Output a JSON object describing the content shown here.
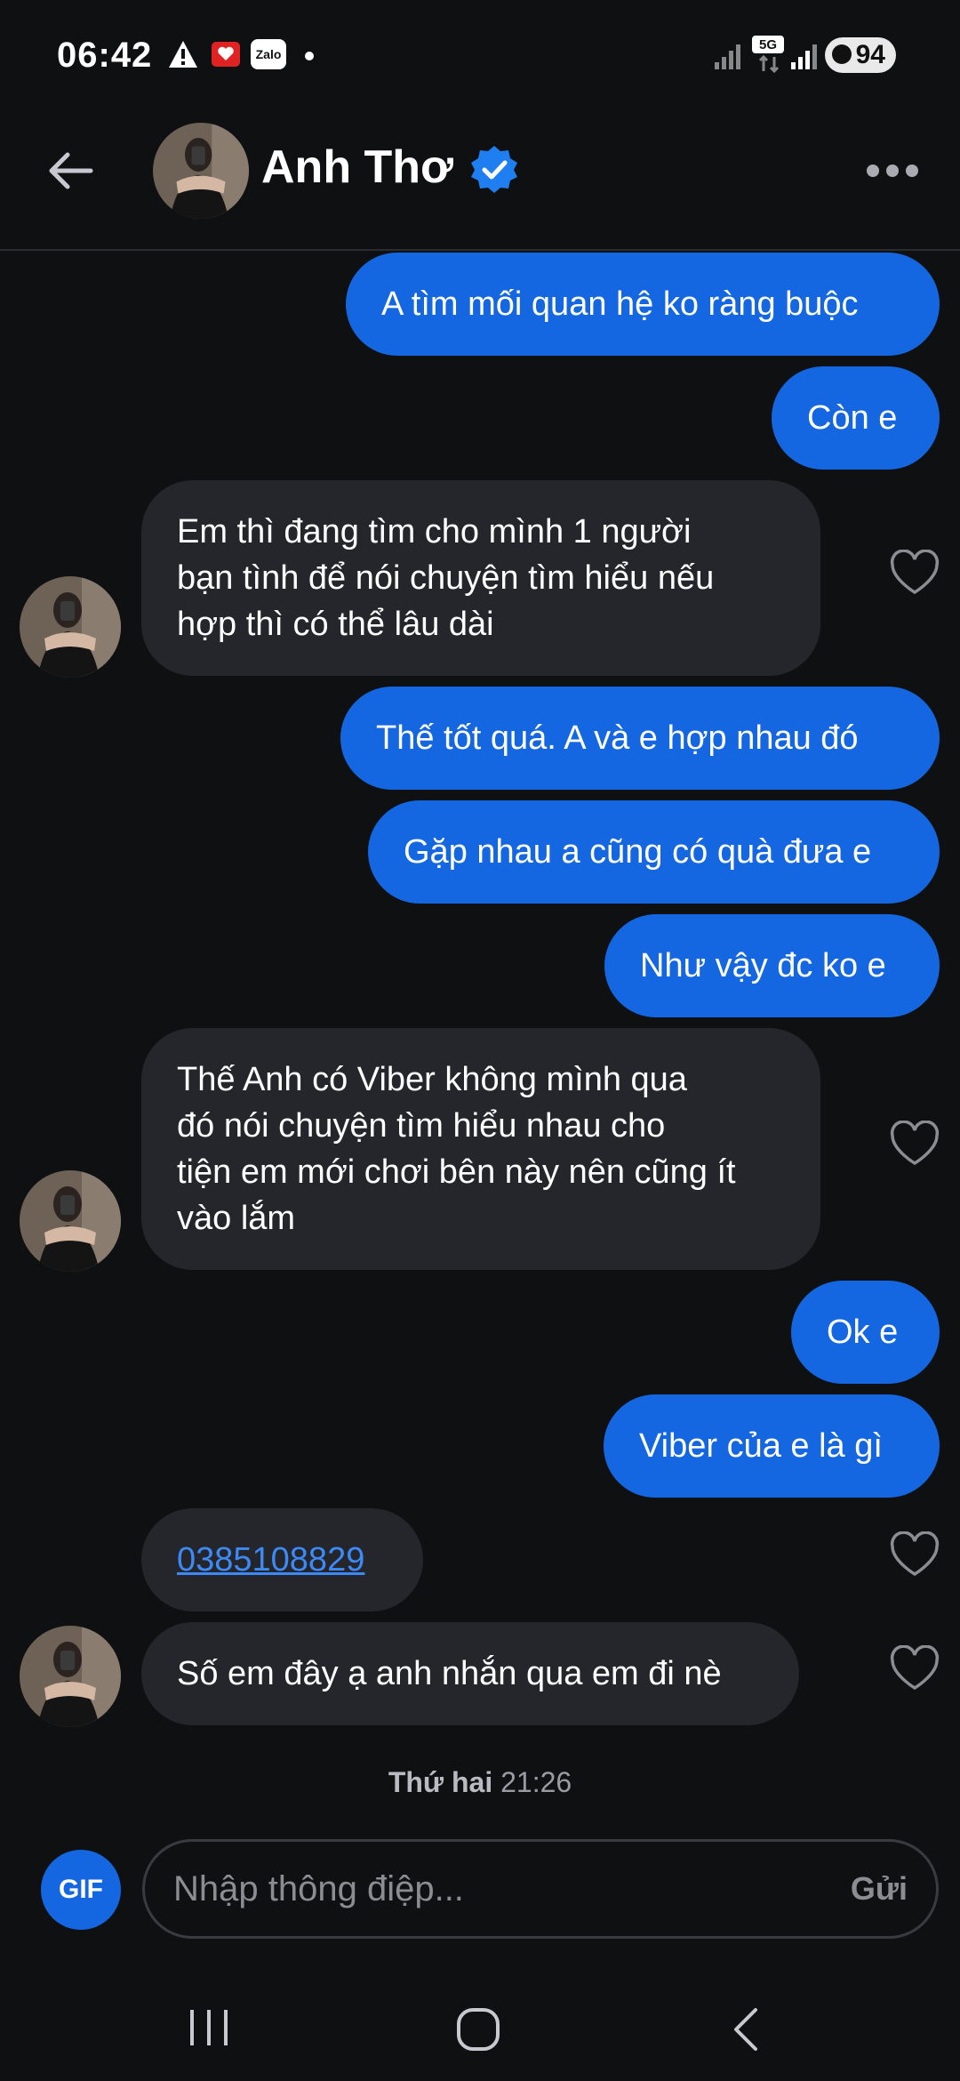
{
  "status_bar": {
    "time": "06:42",
    "notification_icons": [
      "warning-icon",
      "app-notification-icon",
      "zalo-icon",
      "dot-icon"
    ],
    "zalo_label": "Zalo",
    "network_label": "5G",
    "battery": "94"
  },
  "header": {
    "contact_name": "Anh Thơ",
    "verified": true
  },
  "messages": [
    {
      "from": "me",
      "text": "A tìm mối quan hệ ko ràng buộc"
    },
    {
      "from": "me",
      "text": "Còn e"
    },
    {
      "from": "them",
      "text": "Em thì đang tìm cho mình 1 người\nbạn tình để nói chuyện tìm hiểu nếu\nhợp thì có thể lâu dài"
    },
    {
      "from": "me",
      "text": "Thế tốt quá. A và e hợp nhau đó"
    },
    {
      "from": "me",
      "text": "Gặp nhau a cũng có quà đưa e"
    },
    {
      "from": "me",
      "text": "Như vậy đc ko e"
    },
    {
      "from": "them",
      "text": "Thế Anh có Viber không mình qua\nđó nói chuyện tìm hiểu nhau cho\ntiện em mới chơi bên này nên cũng ít\nvào lắm"
    },
    {
      "from": "me",
      "text": "Ok e"
    },
    {
      "from": "me",
      "text": "Viber của e là gì"
    },
    {
      "from": "them",
      "text": "0385108829",
      "type": "link"
    },
    {
      "from": "them",
      "text": "Số em đây ạ anh nhắn qua em đi nè"
    }
  ],
  "day_label": {
    "day": "Thứ hai",
    "time": "21:26"
  },
  "composer": {
    "gif_label": "GIF",
    "placeholder": "Nhập thông điệp...",
    "send_label": "Gửi"
  },
  "colors": {
    "background": "#0f1012",
    "outgoing_bubble": "#1467e0",
    "incoming_bubble": "#25262b",
    "link": "#3d8af7",
    "verified_badge": "#1f7ef0"
  }
}
